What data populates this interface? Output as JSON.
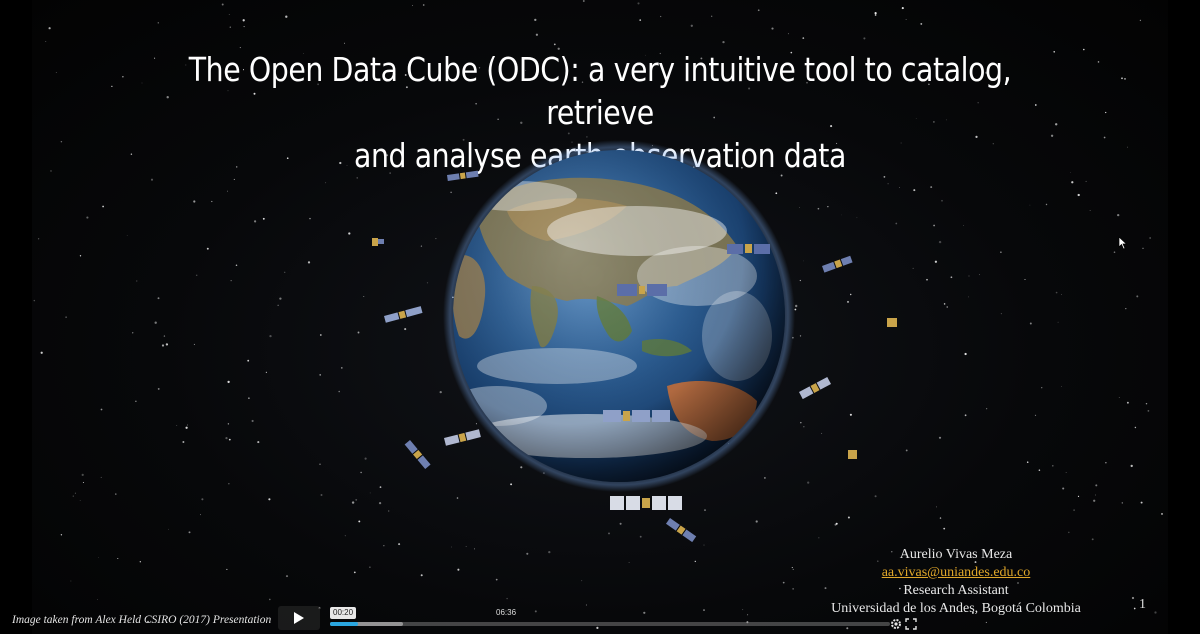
{
  "slide": {
    "title_line1": "The Open Data Cube (ODC): a very intuitive tool to catalog, retrieve",
    "title_line2": "and analyse earth observation data",
    "author": "Aurelio Vivas Meza",
    "email": "aa.vivas@uniandes.edu.co",
    "role": "Research Assistant",
    "affiliation": "Universidad de los Andes, Bogotá Colombia",
    "slide_number": "1",
    "image_caption": "Image taken from  Alex Held CSIRO (2017) Presentation",
    "link_color": "#e0a72a"
  },
  "player": {
    "current_time": "00:20",
    "duration": "06:36",
    "played_fraction": 0.05,
    "buffered_fraction": 0.13,
    "accent_color": "#2aa6e0",
    "play_icon": "play-icon",
    "settings_icon": "gear-icon",
    "fullscreen_icon": "fullscreen-icon"
  }
}
